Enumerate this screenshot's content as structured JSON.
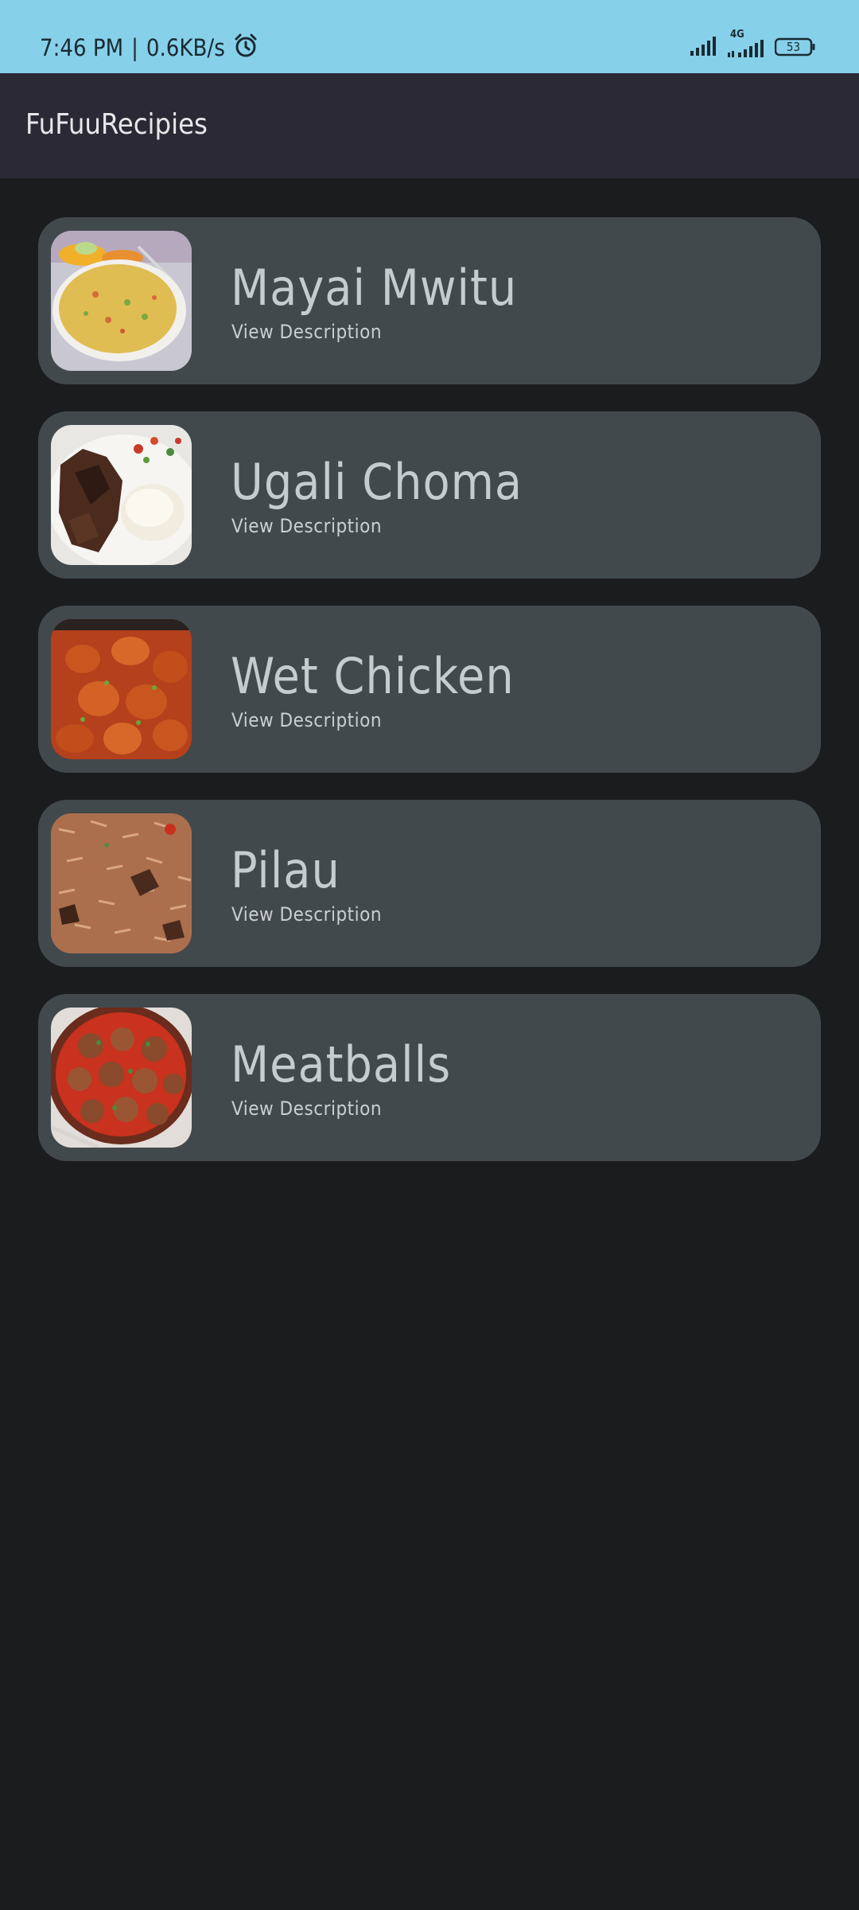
{
  "status_bar": {
    "time": "7:46 PM",
    "separator": "|",
    "speed": "0.6KB/s",
    "network_label": "4G",
    "battery": "53"
  },
  "app_bar": {
    "title": "FuFuuRecipies"
  },
  "recipes": [
    {
      "name": "Mayai Mwitu",
      "link": "View Description"
    },
    {
      "name": "Ugali Choma",
      "link": "View Description"
    },
    {
      "name": "Wet Chicken",
      "link": "View Description"
    },
    {
      "name": "Pilau",
      "link": "View Description"
    },
    {
      "name": "Meatballs",
      "link": "View Description"
    }
  ]
}
